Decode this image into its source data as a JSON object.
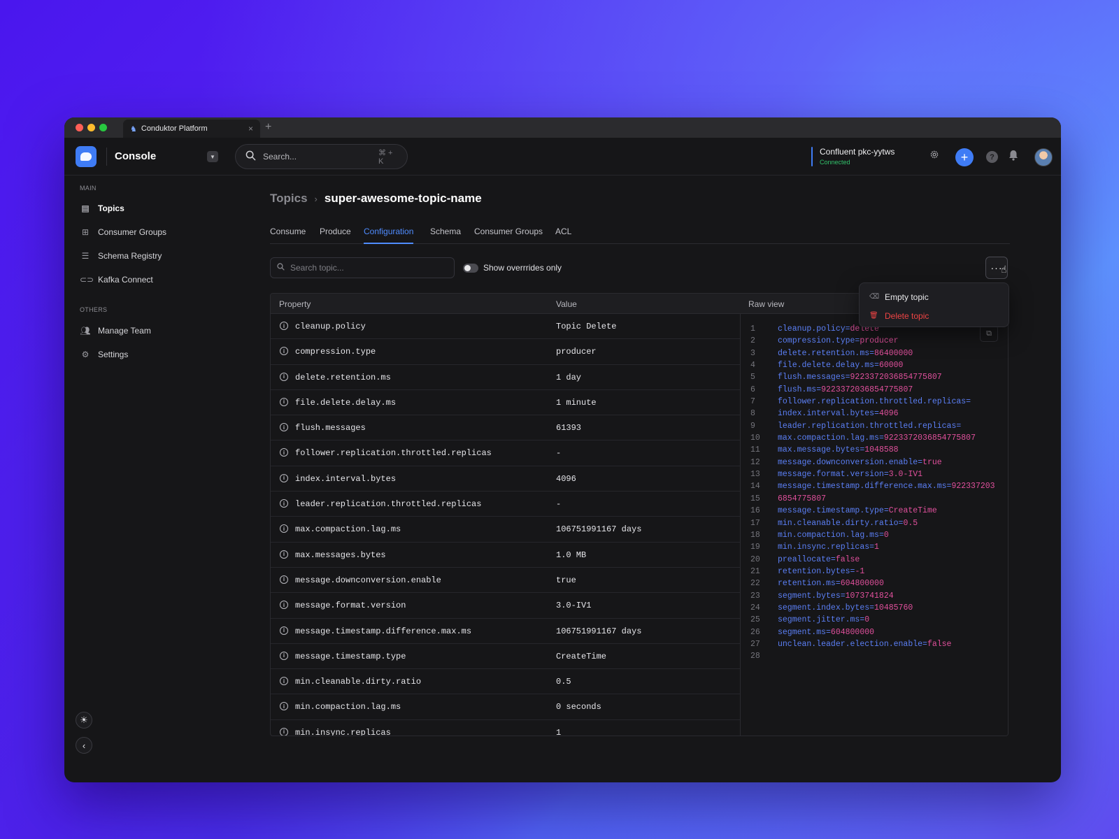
{
  "browser": {
    "tab_title": "Conduktor Platform",
    "tab_close": "×",
    "new_tab": "+"
  },
  "header": {
    "app_title": "Console",
    "search_placeholder": "Search...",
    "search_shortcut": "⌘ + K",
    "cluster_name": "Confluent pkc-yytws",
    "cluster_status": "Connected",
    "accent_color": "#3f7cf5",
    "status_color": "#32c36b"
  },
  "sidebar": {
    "main_section": "MAIN",
    "main_items": [
      {
        "label": "Topics",
        "icon": "topics-icon",
        "active": true
      },
      {
        "label": "Consumer Groups",
        "icon": "consumer-groups-icon"
      },
      {
        "label": "Schema Registry",
        "icon": "schema-registry-icon"
      },
      {
        "label": "Kafka Connect",
        "icon": "kafka-connect-icon"
      }
    ],
    "others_section": "OTHERS",
    "other_items": [
      {
        "label": "Manage Team",
        "icon": "team-icon"
      },
      {
        "label": "Settings",
        "icon": "gear-icon"
      }
    ]
  },
  "breadcrumb": {
    "parent": "Topics",
    "separator": "›",
    "current": "super-awesome-topic-name"
  },
  "tabs": [
    "Consume",
    "Produce",
    "Configuration",
    "Schema",
    "Consumer Groups",
    "ACL"
  ],
  "active_tab": "Configuration",
  "filters": {
    "search_placeholder": "Search topic...",
    "toggle_label": "Show overrrides only",
    "toggle_on": false
  },
  "menu": {
    "more_label": "···",
    "items": [
      {
        "label": "Empty topic",
        "icon": "eraser-icon"
      },
      {
        "label": "Delete topic",
        "icon": "trash-icon",
        "danger": true
      }
    ]
  },
  "table": {
    "columns": [
      "Property",
      "Value",
      "Raw view"
    ],
    "rows": [
      {
        "property": "cleanup.policy",
        "value": "Topic Delete"
      },
      {
        "property": "compression.type",
        "value": "producer"
      },
      {
        "property": "delete.retention.ms",
        "value": "1 day"
      },
      {
        "property": "file.delete.delay.ms",
        "value": "1 minute"
      },
      {
        "property": "flush.messages",
        "value": "61393"
      },
      {
        "property": "follower.replication.throttled.replicas",
        "value": "-"
      },
      {
        "property": "index.interval.bytes",
        "value": "4096"
      },
      {
        "property": "leader.replication.throttled.replicas",
        "value": "-"
      },
      {
        "property": "max.compaction.lag.ms",
        "value": "106751991167 days"
      },
      {
        "property": "max.messages.bytes",
        "value": "1.0 MB"
      },
      {
        "property": "message.downconversion.enable",
        "value": "true"
      },
      {
        "property": "message.format.version",
        "value": "3.0-IV1"
      },
      {
        "property": "message.timestamp.difference.max.ms",
        "value": "106751991167 days"
      },
      {
        "property": "message.timestamp.type",
        "value": "CreateTime"
      },
      {
        "property": "min.cleanable.dirty.ratio",
        "value": "0.5"
      },
      {
        "property": "min.compaction.lag.ms",
        "value": "0 seconds"
      },
      {
        "property": "min.insync.replicas",
        "value": "1"
      }
    ]
  },
  "raw_view": {
    "lines": [
      {
        "n": "1",
        "k": "cleanup.policy",
        "v": "delete"
      },
      {
        "n": "2",
        "k": "compression.type",
        "v": "producer"
      },
      {
        "n": "3",
        "k": "delete.retention.ms",
        "v": "86400000"
      },
      {
        "n": "4",
        "k": "file.delete.delay.ms",
        "v": "60000"
      },
      {
        "n": "5",
        "k": "flush.messages",
        "v": "9223372036854775807"
      },
      {
        "n": "6",
        "k": "flush.ms",
        "v": "9223372036854775807"
      },
      {
        "n": "7",
        "k": "follower.replication.throttled.replicas",
        "v": ""
      },
      {
        "n": "8",
        "k": "index.interval.bytes",
        "v": "4096"
      },
      {
        "n": "9",
        "k": "leader.replication.throttled.replicas",
        "v": ""
      },
      {
        "n": "10",
        "k": "max.compaction.lag.ms",
        "v": "9223372036854775807"
      },
      {
        "n": "11",
        "k": "max.message.bytes",
        "v": "1048588"
      },
      {
        "n": "12",
        "k": "message.downconversion.enable",
        "v": "true"
      },
      {
        "n": "13",
        "k": "message.format.version",
        "v": "3.0-IV1"
      },
      {
        "n": "14",
        "k": "message.timestamp.difference.max.ms",
        "v": "922337203"
      },
      {
        "n": "15",
        "k": "",
        "v": "6854775807",
        "continuation": true
      },
      {
        "n": "16",
        "k": "message.timestamp.type",
        "v": "CreateTime"
      },
      {
        "n": "17",
        "k": "min.cleanable.dirty.ratio",
        "v": "0.5"
      },
      {
        "n": "18",
        "k": "min.compaction.lag.ms",
        "v": "0"
      },
      {
        "n": "19",
        "k": "min.insync.replicas",
        "v": "1"
      },
      {
        "n": "20",
        "k": "preallocate",
        "v": "false"
      },
      {
        "n": "21",
        "k": "retention.bytes",
        "v": "-1"
      },
      {
        "n": "22",
        "k": "retention.ms",
        "v": "604800000"
      },
      {
        "n": "23",
        "k": "segment.bytes",
        "v": "1073741824"
      },
      {
        "n": "24",
        "k": "segment.index.bytes",
        "v": "10485760"
      },
      {
        "n": "25",
        "k": "segment.jitter.ms",
        "v": "0"
      },
      {
        "n": "26",
        "k": "segment.ms",
        "v": "604800000"
      },
      {
        "n": "27",
        "k": "unclean.leader.election.enable",
        "v": "false"
      },
      {
        "n": "28",
        "k": "",
        "v": "",
        "continuation": true
      }
    ]
  }
}
